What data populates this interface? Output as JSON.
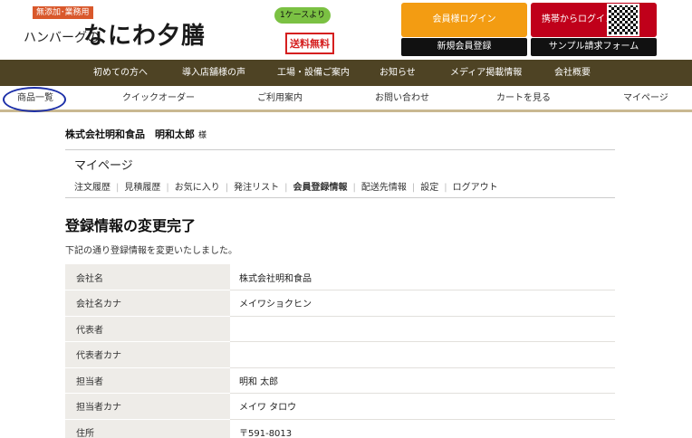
{
  "header": {
    "logo_badge": "無添加･業務用",
    "logo_sub": "ハンバーグの",
    "logo_main": "なにわ夕膳",
    "promo_tag": "1ケースより",
    "promo_box": "送料無料",
    "login_button": "会員様ログイン",
    "mobile_login_button": "携帯からログイン",
    "register_button": "新規会員登録",
    "sample_button": "サンプル請求フォーム"
  },
  "topnav": {
    "items": [
      "初めての方へ",
      "導入店舗様の声",
      "工場・設備ご案内",
      "お知らせ",
      "メディア掲載情報",
      "会社概要"
    ]
  },
  "subnav": {
    "items": [
      "商品一覧",
      "クイックオーダー",
      "ご利用案内",
      "お問い合わせ",
      "カートを見る",
      "マイページ"
    ]
  },
  "user": {
    "name": "株式会社明和食品　明和太郎",
    "honorific": "様"
  },
  "mypage": {
    "title": "マイページ",
    "tabs": [
      "注文履歴",
      "見積履歴",
      "お気に入り",
      "発注リスト",
      "会員登録情報",
      "配送先情報",
      "設定",
      "ログアウト"
    ],
    "active_tab": "会員登録情報"
  },
  "main": {
    "heading": "登録情報の変更完了",
    "description": "下記の通り登録情報を変更いたしました。",
    "rows": [
      {
        "label": "会社名",
        "value": "株式会社明和食品"
      },
      {
        "label": "会社名カナ",
        "value": "メイワショクヒン"
      },
      {
        "label": "代表者",
        "value": ""
      },
      {
        "label": "代表者カナ",
        "value": ""
      },
      {
        "label": "担当者",
        "value": "明和 太郎"
      },
      {
        "label": "担当者カナ",
        "value": "メイワ タロウ"
      },
      {
        "label": "住所",
        "value": "〒591-8013"
      }
    ]
  }
}
